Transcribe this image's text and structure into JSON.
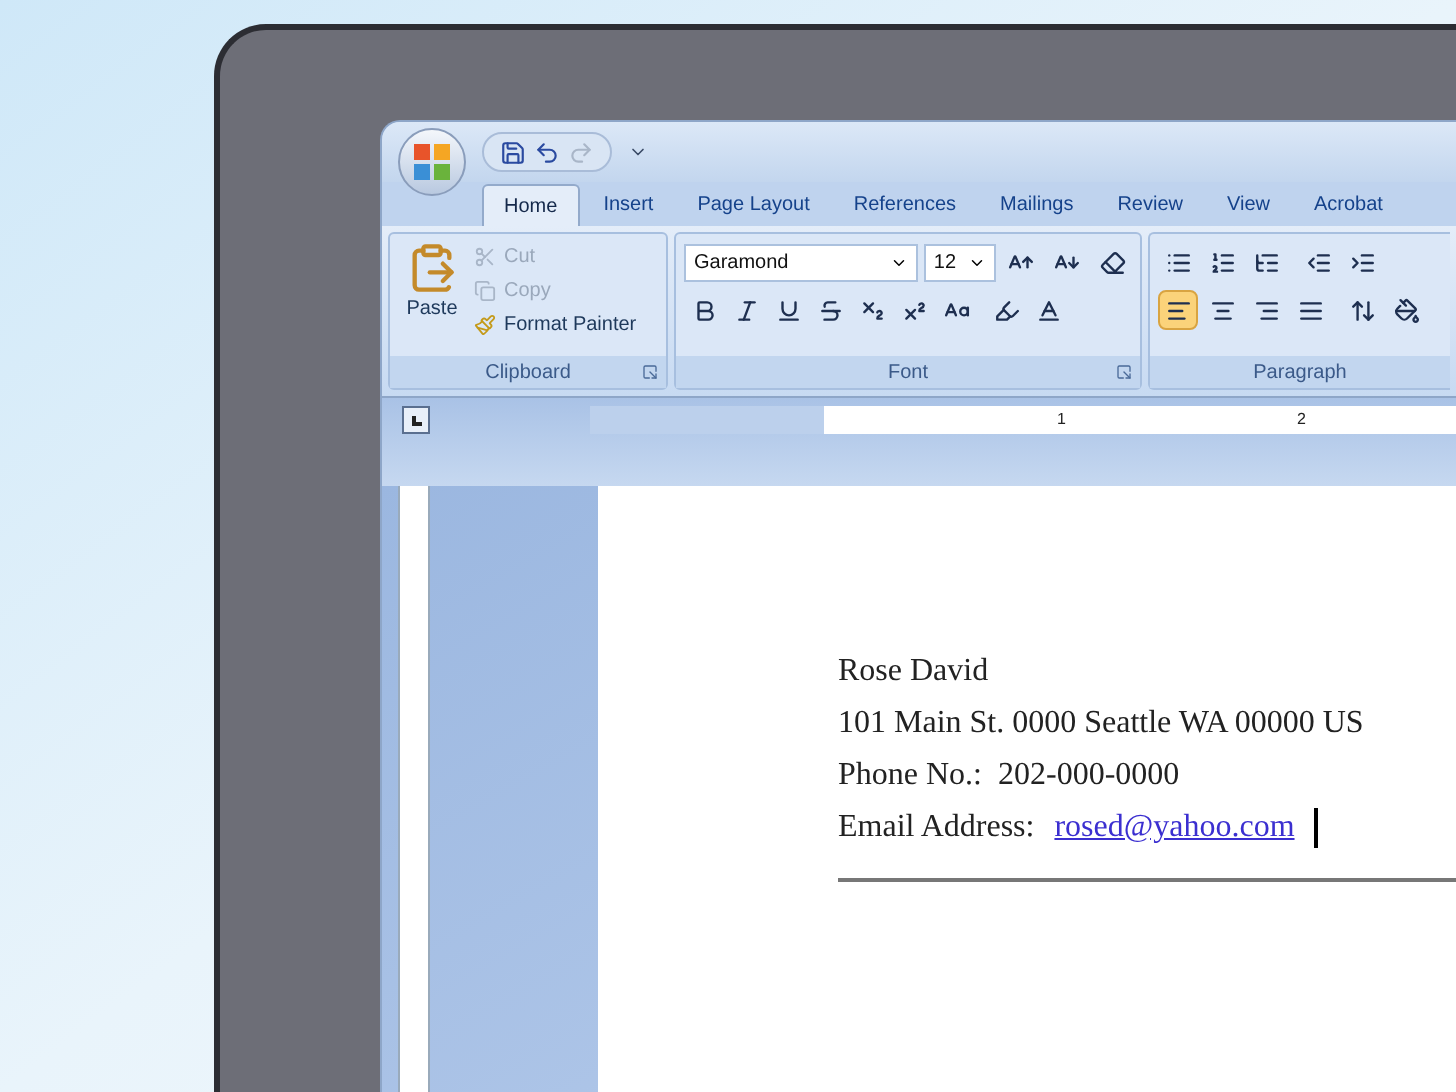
{
  "quick_access": [
    {
      "kind": "save",
      "disabled": false
    },
    {
      "kind": "undo",
      "disabled": false
    },
    {
      "kind": "redo",
      "disabled": true
    }
  ],
  "tabs": [
    {
      "label": "Home",
      "selected": true
    },
    {
      "label": "Insert",
      "selected": false
    },
    {
      "label": "Page Layout",
      "selected": false
    },
    {
      "label": "References",
      "selected": false
    },
    {
      "label": "Mailings",
      "selected": false
    },
    {
      "label": "Review",
      "selected": false
    },
    {
      "label": "View",
      "selected": false
    },
    {
      "label": "Acrobat",
      "selected": false
    }
  ],
  "clipboard": {
    "paste": "Paste",
    "group_label": "Clipboard",
    "items": [
      {
        "kind": "cut",
        "label": "Cut",
        "disabled": true
      },
      {
        "kind": "copy",
        "label": "Copy",
        "disabled": true
      },
      {
        "kind": "painter",
        "label": "Format Painter",
        "disabled": false
      }
    ]
  },
  "font": {
    "name": "Garamond",
    "size": "12",
    "group_label": "Font"
  },
  "paragraph": {
    "group_label": "Paragraph",
    "alignments": [
      {
        "kind": "left",
        "selected": true
      },
      {
        "kind": "center",
        "selected": false
      },
      {
        "kind": "right",
        "selected": false
      },
      {
        "kind": "justify",
        "selected": false
      }
    ]
  },
  "ruler": {
    "labels": [
      "1",
      "2"
    ]
  },
  "document": {
    "cursor_visible": true,
    "lines": [
      {
        "kind": "text",
        "text": "Rose David"
      },
      {
        "kind": "text",
        "text": "101 Main St. 0000 Seattle WA 00000 US"
      },
      {
        "kind": "text",
        "text": "Phone No.:  202-000-0000"
      },
      {
        "kind": "email",
        "label": "Email Address:",
        "link": "rosed@yahoo.com"
      }
    ]
  }
}
